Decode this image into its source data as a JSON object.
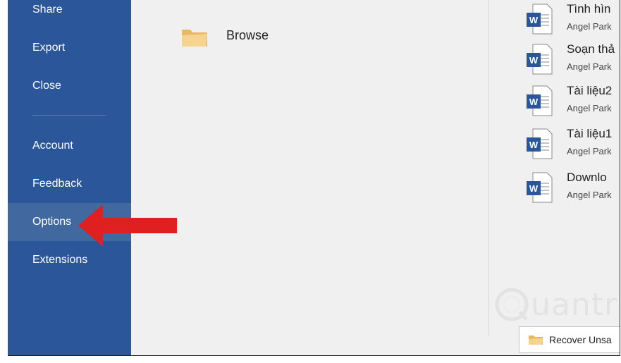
{
  "sidebar": {
    "items": [
      {
        "label": "Share"
      },
      {
        "label": "Export"
      },
      {
        "label": "Close"
      },
      {
        "label": "Account"
      },
      {
        "label": "Feedback"
      },
      {
        "label": "Options"
      },
      {
        "label": "Extensions"
      }
    ],
    "active_item": "Options",
    "bg_color": "#2b579a"
  },
  "main": {
    "browse_label": "Browse",
    "recent_files": [
      {
        "name": "Tình hìn",
        "author": "Angel Park"
      },
      {
        "name": "Soạn thả",
        "author": "Angel Park"
      },
      {
        "name": "Tài liệu2",
        "author": "Angel Park"
      },
      {
        "name": "Tài liệu1",
        "author": "Angel Park"
      },
      {
        "name": "Downlo",
        "author": "Angel Park"
      }
    ],
    "recover_label": "Recover Unsa"
  },
  "watermark": {
    "text": "uantrimang"
  },
  "annotation": {
    "color": "#e02020",
    "icon": "red-arrow-icon"
  }
}
